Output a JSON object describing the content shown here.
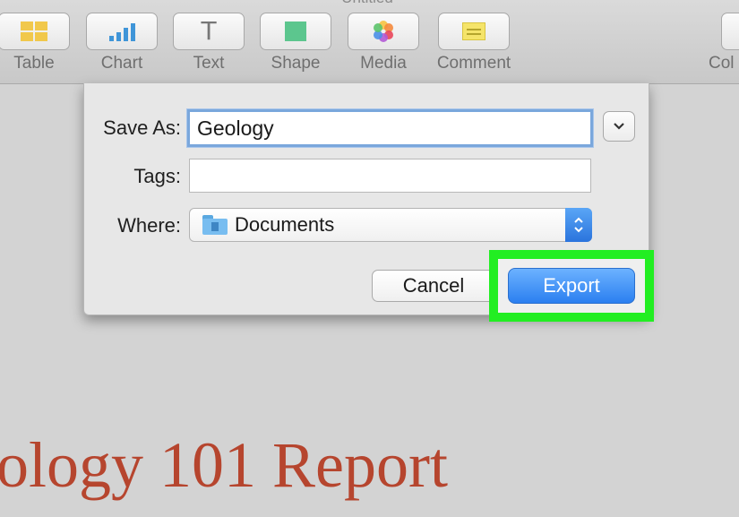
{
  "window": {
    "title": "Untitled"
  },
  "toolbar": {
    "items": [
      {
        "label": "Table",
        "icon": "table-icon"
      },
      {
        "label": "Chart",
        "icon": "chart-icon"
      },
      {
        "label": "Text",
        "icon": "text-icon"
      },
      {
        "label": "Shape",
        "icon": "shape-icon"
      },
      {
        "label": "Media",
        "icon": "media-icon"
      },
      {
        "label": "Comment",
        "icon": "comment-icon"
      },
      {
        "label": "Col",
        "icon": ""
      }
    ],
    "text_glyph": "T"
  },
  "dialog": {
    "save_as_label": "Save As:",
    "save_as_value": "Geology",
    "tags_label": "Tags:",
    "tags_value": "",
    "where_label": "Where:",
    "where_value": "Documents",
    "cancel_label": "Cancel",
    "export_label": "Export"
  },
  "document": {
    "title": "ology 101 Report"
  },
  "colors": {
    "highlight": "#22ee22",
    "export_button": "#2b7ff0",
    "document_title": "#b6452e"
  }
}
